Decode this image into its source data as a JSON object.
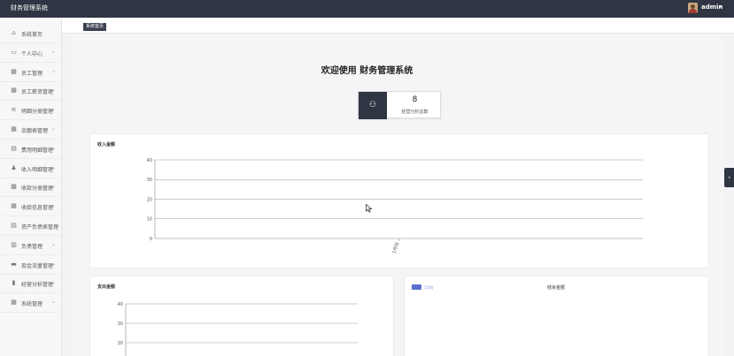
{
  "header": {
    "app_title": "财务管理系统",
    "username": "admin",
    "caret": "▾"
  },
  "sidebar": {
    "items": [
      {
        "label": "系统首页",
        "icon": "home-icon",
        "glyph": "⌂",
        "has_chevron": false
      },
      {
        "label": "个人中心",
        "icon": "calendar-icon",
        "glyph": "▭",
        "has_chevron": true
      },
      {
        "label": "员工管理",
        "icon": "grid-icon",
        "glyph": "▦",
        "has_chevron": true
      },
      {
        "label": "员工薪资管理",
        "icon": "grid-icon",
        "glyph": "▦",
        "has_chevron": true
      },
      {
        "label": "明细分类管理",
        "icon": "list-icon",
        "glyph": "≡",
        "has_chevron": true
      },
      {
        "label": "余额表管理",
        "icon": "grid-icon",
        "glyph": "▦",
        "has_chevron": true
      },
      {
        "label": "费用明细管理",
        "icon": "table-icon",
        "glyph": "▤",
        "has_chevron": true
      },
      {
        "label": "收入明细管理",
        "icon": "user-icon",
        "glyph": "♟",
        "has_chevron": true
      },
      {
        "label": "收款分类管理",
        "icon": "grid-icon",
        "glyph": "▦",
        "has_chevron": true
      },
      {
        "label": "收款信息管理",
        "icon": "grid-icon",
        "glyph": "▦",
        "has_chevron": true
      },
      {
        "label": "资产负债表管理",
        "icon": "table-icon",
        "glyph": "▤",
        "has_chevron": false
      },
      {
        "label": "负债管理",
        "icon": "trash-icon",
        "glyph": "▥",
        "has_chevron": true
      },
      {
        "label": "现金流量管理",
        "icon": "printer-icon",
        "glyph": "▬",
        "has_chevron": true
      },
      {
        "label": "经营分析管理",
        "icon": "bar-chart-icon",
        "glyph": "▮",
        "has_chevron": true
      },
      {
        "label": "系统管理",
        "icon": "grid-icon",
        "glyph": "▦",
        "has_chevron": true
      }
    ],
    "chevron": "⌄"
  },
  "tabs": {
    "active": "系统首页"
  },
  "welcome": {
    "text": "欢迎使用 财务管理系统"
  },
  "stat": {
    "value": "8",
    "label": "经营分析总数",
    "icon": "stamp-icon",
    "glyph": "⚇"
  },
  "income_panel": {
    "title": "收入金额"
  },
  "expense_panel": {
    "title": "支出金额"
  },
  "balance_panel": {
    "title": "结余金额",
    "legend": "1月份"
  },
  "handle_glyph": "‹",
  "colors": {
    "topbar": "#2f3542",
    "accent": "#5b6fcf"
  },
  "chart_data": [
    {
      "type": "bar",
      "title": "收入金额",
      "categories": [
        "1月份"
      ],
      "values": [
        0
      ],
      "ylim": [
        0,
        40
      ],
      "yticks": [
        0,
        10,
        20,
        30,
        40
      ],
      "grid": true
    },
    {
      "type": "bar",
      "title": "支出金额",
      "categories": [],
      "values": [],
      "ylim": [
        0,
        40
      ],
      "yticks": [
        20,
        30,
        40
      ],
      "grid": true
    },
    {
      "type": "pie",
      "title": "结余金额",
      "categories": [
        "1月份"
      ],
      "values": [],
      "legend": "top-left"
    }
  ]
}
